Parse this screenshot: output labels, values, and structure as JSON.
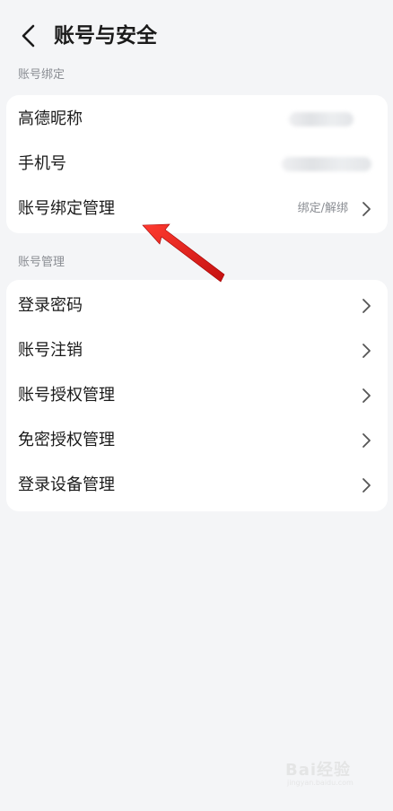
{
  "header": {
    "title": "账号与安全",
    "back_icon": "chevron-left-icon"
  },
  "sections": [
    {
      "label": "账号绑定",
      "items": [
        {
          "label": "高德昵称",
          "value": "",
          "value_blurred": true
        },
        {
          "label": "手机号",
          "value": "",
          "value_blurred": true
        },
        {
          "label": "账号绑定管理",
          "value": "绑定/解绑",
          "chevron": true
        }
      ]
    },
    {
      "label": "账号管理",
      "items": [
        {
          "label": "登录密码",
          "chevron": true
        },
        {
          "label": "账号注销",
          "chevron": true
        },
        {
          "label": "账号授权管理",
          "chevron": true
        },
        {
          "label": "免密授权管理",
          "chevron": true
        },
        {
          "label": "登录设备管理",
          "chevron": true
        }
      ]
    }
  ],
  "annotation": {
    "type": "red-arrow",
    "color": "#e02020"
  },
  "watermark": {
    "text": "Bai经验",
    "sub": "jingyan.baidu.com"
  },
  "colors": {
    "background": "#f4f5f7",
    "card": "#ffffff",
    "text_primary": "#1b1b1b",
    "text_secondary": "#8a8d93"
  }
}
